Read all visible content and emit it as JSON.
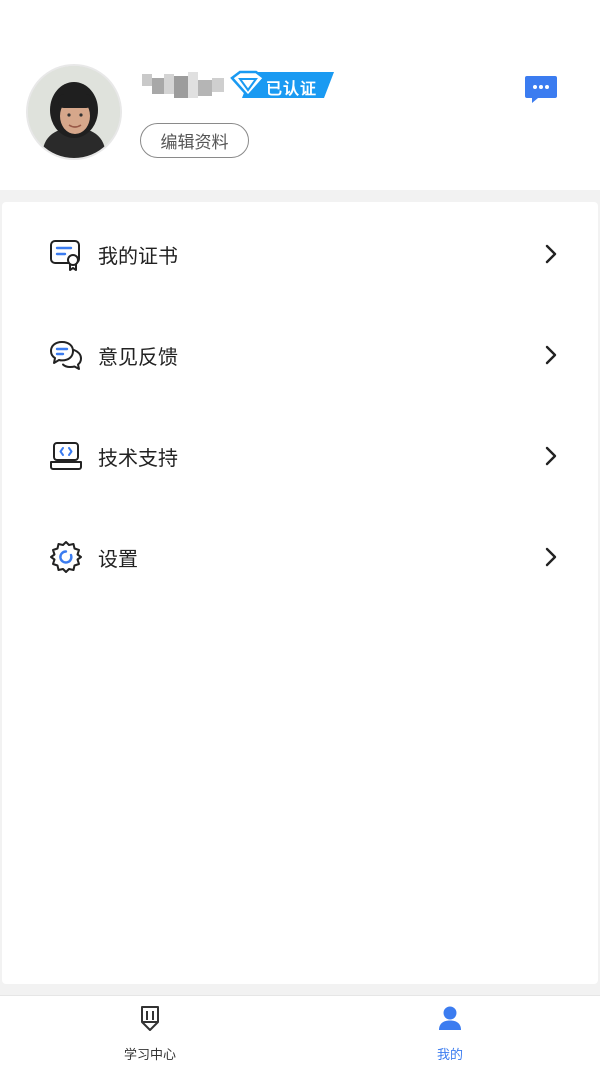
{
  "profile": {
    "username": "",
    "verified_label": "已认证",
    "edit_label": "编辑资料"
  },
  "menu": {
    "items": [
      {
        "label": "我的证书",
        "icon": "certificate-icon"
      },
      {
        "label": "意见反馈",
        "icon": "feedback-icon"
      },
      {
        "label": "技术支持",
        "icon": "tech-support-icon"
      },
      {
        "label": "设置",
        "icon": "settings-icon"
      }
    ]
  },
  "tabbar": {
    "tabs": [
      {
        "label": "学习中心",
        "icon": "study-center-icon",
        "active": false
      },
      {
        "label": "我的",
        "icon": "profile-icon",
        "active": true
      }
    ]
  },
  "colors": {
    "accent": "#3b7cf0",
    "badge_blue": "#1a9af2",
    "text": "#222222",
    "muted": "#555555"
  }
}
